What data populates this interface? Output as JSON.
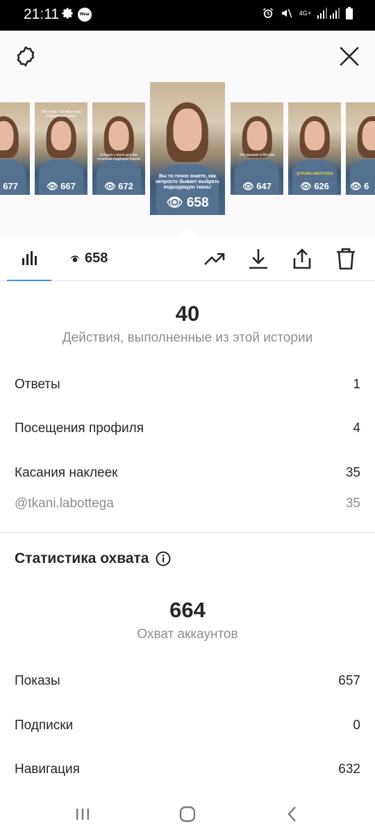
{
  "status_bar": {
    "time": "21:11",
    "app_badge": "Wear",
    "network": "4G+",
    "icons": [
      "gear-icon",
      "alarm-icon",
      "mute-icon",
      "signal-icon",
      "battery-icon"
    ]
  },
  "header": {
    "left_icon": "settings-icon",
    "right_icon": "close-icon"
  },
  "stories": [
    {
      "views": "677",
      "caption": ""
    },
    {
      "views": "667",
      "caption": "Уже знаю, что такое ваш подходящую ткань"
    },
    {
      "views": "672",
      "caption": "Сегодня у меня для вас отличная подборка тканей"
    },
    {
      "views": "658",
      "caption": "Вы то точно знаете, как непросто бывает выбрать подходящую ткань!"
    },
    {
      "views": "647",
      "caption": "Это магазин в Москве"
    },
    {
      "views": "626",
      "caption": "@TKANI.LABOTTEGA"
    },
    {
      "views": "6",
      "caption": ""
    }
  ],
  "toolbar": {
    "views": "658",
    "icons": [
      "bar-chart-icon",
      "eye-icon",
      "trending-icon",
      "download-icon",
      "share-icon",
      "trash-icon"
    ]
  },
  "actions": {
    "total": "40",
    "caption": "Действия, выполненные из этой истории",
    "rows": [
      {
        "label": "Ответы",
        "value": "1"
      },
      {
        "label": "Посещения профиля",
        "value": "4"
      },
      {
        "label": "Касания наклеек",
        "value": "35"
      }
    ],
    "sub_row": {
      "label": "@tkani.labottega",
      "value": "35"
    }
  },
  "reach": {
    "title": "Статистика охвата",
    "total": "664",
    "caption": "Охват аккаунтов",
    "rows": [
      {
        "label": "Показы",
        "value": "657"
      },
      {
        "label": "Подписки",
        "value": "0"
      },
      {
        "label": "Навигация",
        "value": "632"
      }
    ]
  },
  "nav": {
    "icons": [
      "recent-apps-icon",
      "home-icon",
      "back-icon"
    ]
  }
}
